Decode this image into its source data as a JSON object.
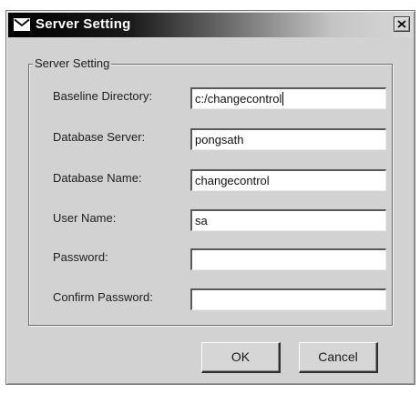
{
  "window": {
    "title": "Server Setting",
    "title_icon": "envelope-icon",
    "close_icon": "close-icon"
  },
  "group": {
    "legend": "Server Setting"
  },
  "fields": [
    {
      "label": "Baseline Directory:",
      "value": "c:/changecontrol",
      "focused": true
    },
    {
      "label": "Database Server:",
      "value": "pongsath",
      "focused": false
    },
    {
      "label": "Database Name:",
      "value": "changecontrol",
      "focused": false
    },
    {
      "label": "User Name:",
      "value": "sa",
      "focused": false
    },
    {
      "label": "Password:",
      "value": "",
      "focused": false
    },
    {
      "label": "Confirm Password:",
      "value": "",
      "focused": false
    }
  ],
  "buttons": {
    "ok": "OK",
    "cancel": "Cancel"
  },
  "colors": {
    "title_bar_start": "#000000",
    "title_bar_end": "#d8d8d8",
    "dialog_face": "#d2d2d2"
  }
}
